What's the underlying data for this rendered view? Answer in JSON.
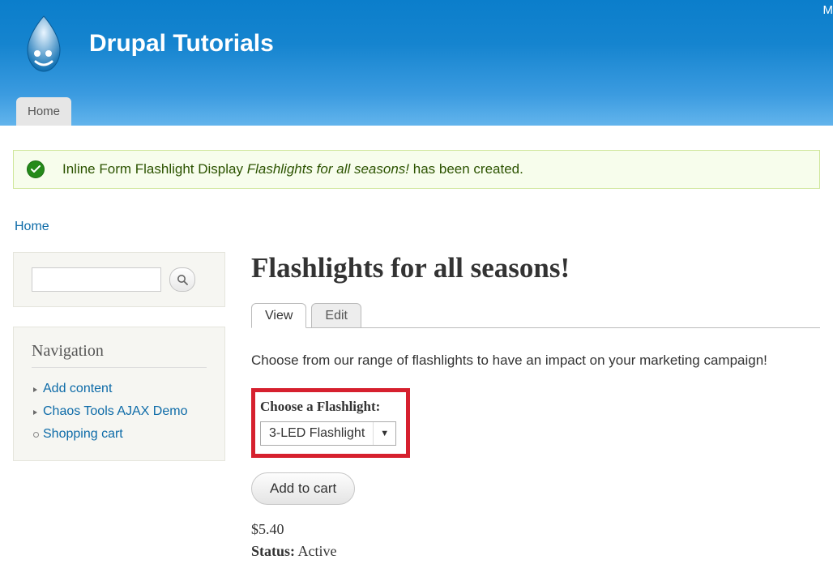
{
  "header": {
    "site_title": "Drupal Tutorials",
    "top_right": "M",
    "home_tab": "Home"
  },
  "status": {
    "prefix": "Inline Form Flashlight Display ",
    "entity": "Flashlights for all seasons!",
    "suffix": " has been created."
  },
  "breadcrumb": {
    "home": "Home"
  },
  "sidebar": {
    "search_placeholder": "",
    "nav_title": "Navigation",
    "items": [
      {
        "label": "Add content"
      },
      {
        "label": "Chaos Tools AJAX Demo"
      },
      {
        "label": "Shopping cart"
      }
    ]
  },
  "main": {
    "page_title": "Flashlights for all seasons!",
    "tabs": {
      "view": "View",
      "edit": "Edit"
    },
    "description": "Choose from our range of flashlights to have an impact on your marketing campaign!",
    "choose_label": "Choose a Flashlight:",
    "select_value": "3-LED Flashlight",
    "add_cart": "Add to cart",
    "price": "$5.40",
    "status_label": "Status:",
    "status_value": " Active"
  }
}
